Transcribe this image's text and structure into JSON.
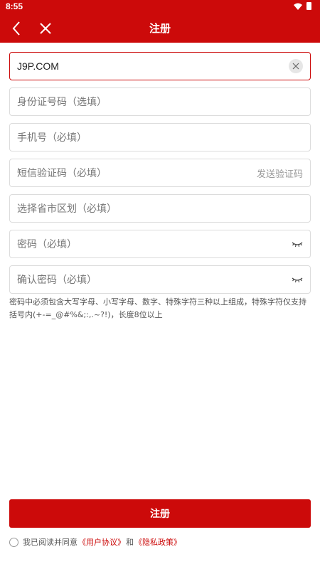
{
  "status_bar": {
    "time": "8:55"
  },
  "header": {
    "title": "注册"
  },
  "form": {
    "username": {
      "value": "J9P.COM"
    },
    "id_card": {
      "placeholder": "身份证号码（选填）"
    },
    "phone": {
      "placeholder": "手机号（必填）"
    },
    "sms_code": {
      "placeholder": "短信验证码（必填）",
      "send_label": "发送验证码"
    },
    "region": {
      "placeholder": "选择省市区划（必填）"
    },
    "password": {
      "placeholder": "密码（必填）"
    },
    "confirm_password": {
      "placeholder": "确认密码（必填）"
    }
  },
  "hint": "密码中必须包含大写字母、小写字母、数字、特殊字符三种以上组成，特殊字符仅支持括号内(+-=_@#%&;:,.~?!)，长度8位以上",
  "submit_label": "注册",
  "agreement": {
    "prefix": "我已阅读并同意",
    "user_agreement": "《用户协议》",
    "and": "和",
    "privacy_policy": "《隐私政策》"
  },
  "colors": {
    "brand": "#cc0a0a"
  }
}
